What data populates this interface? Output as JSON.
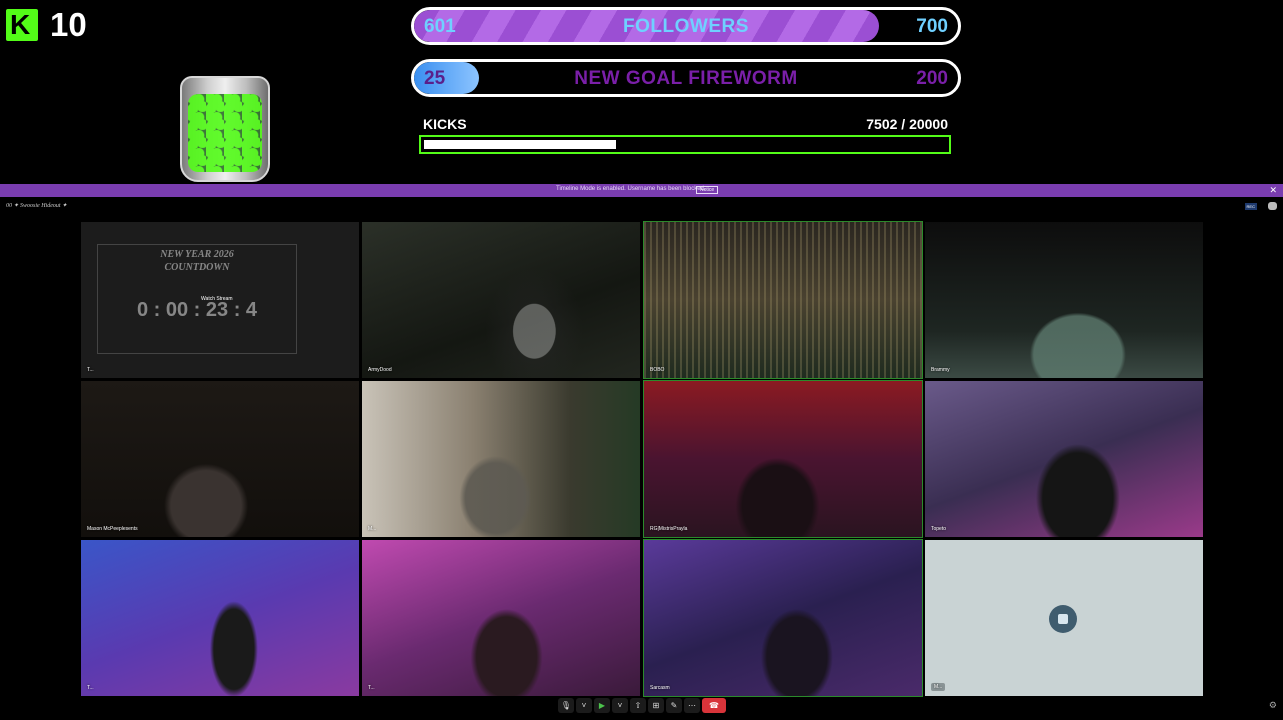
{
  "overlay": {
    "kick_count": "10",
    "followers_goal": {
      "current": "601",
      "label": "FOLLOWERS",
      "target": "700",
      "progress_fraction": 0.855
    },
    "fireworm_goal": {
      "current": "25",
      "label": "NEW GOAL FIREWORM",
      "target": "200",
      "progress_fraction": 0.12
    },
    "kicks": {
      "title": "KICKS",
      "value": "7502  / 20000",
      "progress_fraction": 0.375
    }
  },
  "banner": {
    "message": "Timeline Mode is enabled. Username has been blocked.",
    "button": "Notice",
    "close": "✕"
  },
  "call": {
    "title": "00 ✦ Swoosie Hideout ✦",
    "rec_badge": "REC"
  },
  "tiles": [
    {
      "name": "T..."
    },
    {
      "name": "ArmyDood"
    },
    {
      "name": "BOBO"
    },
    {
      "name": "Brammy"
    },
    {
      "name": "Mason McPeeplesents"
    },
    {
      "name": "M..."
    },
    {
      "name": "RG|MistrisPrayla"
    },
    {
      "name": "Topeto"
    },
    {
      "name": "T..."
    },
    {
      "name": "T..."
    },
    {
      "name": "Sarcasm"
    },
    {
      "name": "M..."
    }
  ],
  "countdown": {
    "line1": "NEW YEAR 2026",
    "line2": "COUNTDOWN",
    "clock": "0 : 00 : 23 : 4",
    "watch": "Watch Stream"
  },
  "toolbar": {
    "mic": "🎙",
    "camera": "▶",
    "share": "⇧",
    "grid": "⊞",
    "effects": "✎",
    "more": "⋯",
    "leave": "☎"
  },
  "colors": {
    "kick_green": "#53fc18",
    "banner_purple": "#7a3db0",
    "followers_fill": "#9b4fd3",
    "fireworm_fill": "#3a8ff0"
  }
}
